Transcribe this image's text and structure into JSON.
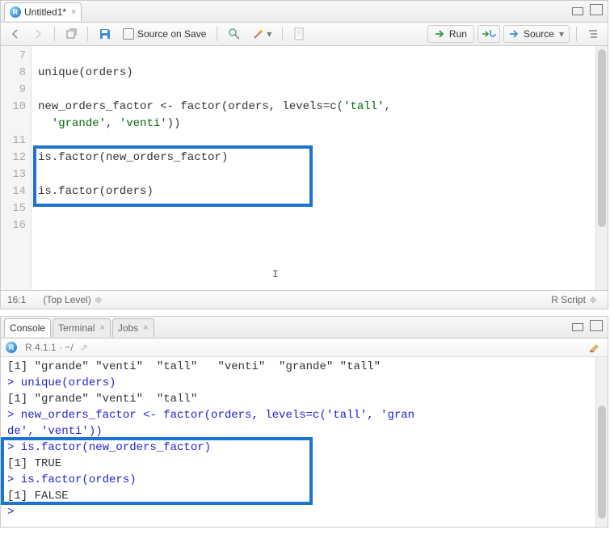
{
  "source_pane": {
    "tab_title": "Untitled1*",
    "toolbar": {
      "source_on_save_label": "Source on Save",
      "run_label": "Run",
      "source_label": "Source"
    },
    "lines": [
      {
        "num": 7,
        "text": ""
      },
      {
        "num": 8,
        "text": "unique(orders)"
      },
      {
        "num": 9,
        "text": ""
      },
      {
        "num": 10,
        "text": "new_orders_factor <- factor(orders, levels=c('tall',"
      },
      {
        "num": "",
        "text": "  'grande', 'venti'))"
      },
      {
        "num": 11,
        "text": ""
      },
      {
        "num": 12,
        "text": "is.factor(new_orders_factor)"
      },
      {
        "num": 13,
        "text": ""
      },
      {
        "num": 14,
        "text": "is.factor(orders)"
      },
      {
        "num": 15,
        "text": ""
      },
      {
        "num": 16,
        "text": ""
      }
    ],
    "status": {
      "cursor": "16:1",
      "scope": "(Top Level)",
      "type": "R Script"
    }
  },
  "console_pane": {
    "tabs": {
      "console": "Console",
      "terminal": "Terminal",
      "jobs": "Jobs"
    },
    "info": "R 4.1.1 · ~/",
    "lines": [
      {
        "kind": "out",
        "text": "[1] \"grande\" \"venti\"  \"tall\"   \"venti\"  \"grande\" \"tall\""
      },
      {
        "kind": "in",
        "text": "> unique(orders)"
      },
      {
        "kind": "out",
        "text": "[1] \"grande\" \"venti\"  \"tall\""
      },
      {
        "kind": "in",
        "text": "> new_orders_factor <- factor(orders, levels=c('tall', 'gran"
      },
      {
        "kind": "in",
        "text": "de', 'venti'))"
      },
      {
        "kind": "in",
        "text": "> is.factor(new_orders_factor)"
      },
      {
        "kind": "out",
        "text": "[1] TRUE"
      },
      {
        "kind": "in",
        "text": "> is.factor(orders)"
      },
      {
        "kind": "out",
        "text": "[1] FALSE"
      },
      {
        "kind": "prompt",
        "text": "> "
      }
    ]
  }
}
